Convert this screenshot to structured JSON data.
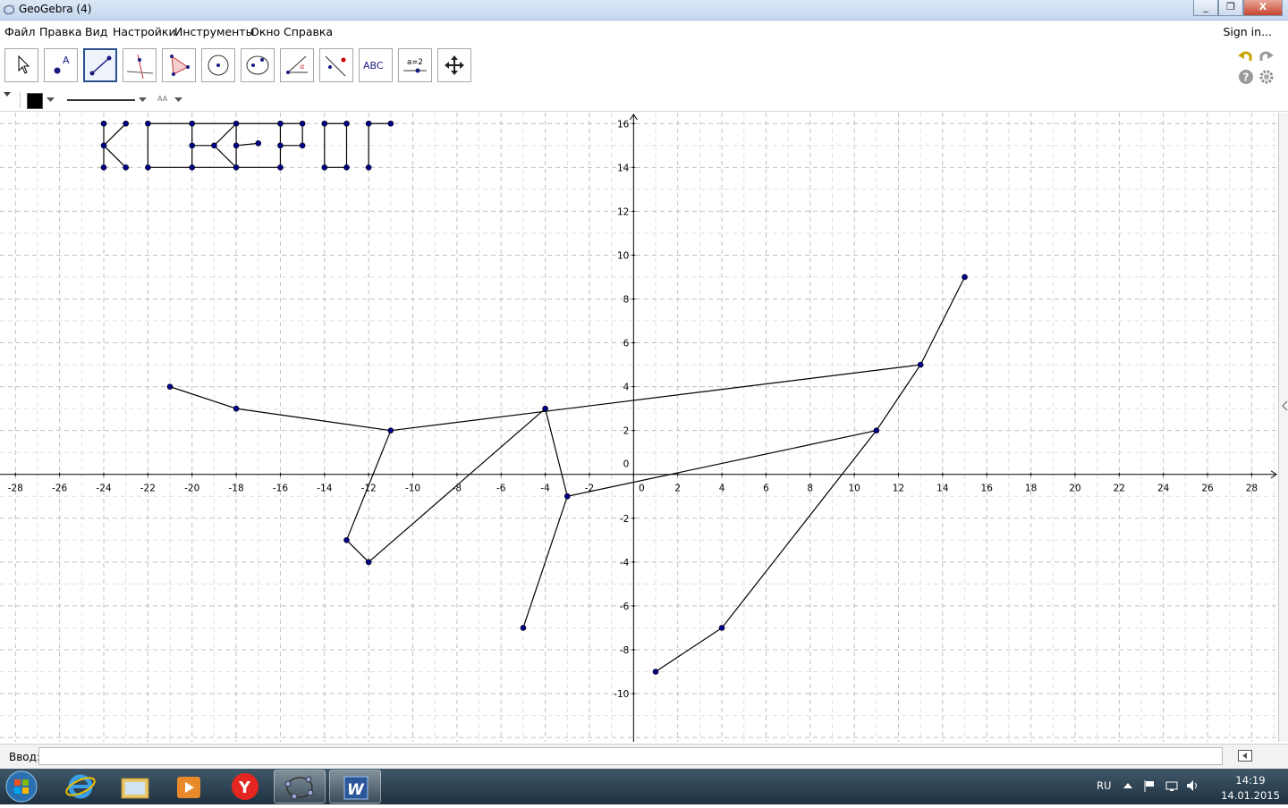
{
  "window": {
    "title": "GeoGebra (4)",
    "buttons": [
      "_",
      "❐",
      "X"
    ]
  },
  "menu": {
    "items": [
      "Файл",
      "Правка",
      "Вид",
      "Настройки",
      "Инструменты",
      "Окно",
      "Справка"
    ],
    "sign_in": "Sign in..."
  },
  "toolbar": {
    "tools": [
      "move-tool",
      "point-tool",
      "line-tool",
      "perpendicular-tool",
      "polygon-tool",
      "circle-tool",
      "conic-tool",
      "angle-tool",
      "reflect-tool",
      "text-tool",
      "slider-tool",
      "move-view-tool"
    ],
    "selected": "line-tool",
    "text_tool_label": "ABC",
    "slider_tool_label": "a=2"
  },
  "stylebar": {
    "color": "#000000",
    "text_size_label": "AA"
  },
  "graph": {
    "x_ticks": [
      "-28",
      "-26",
      "-24",
      "-22",
      "-20",
      "-18",
      "-16",
      "-14",
      "-12",
      "-10",
      "-8",
      "-6",
      "-4",
      "-2",
      "0",
      "2",
      "4",
      "6",
      "8",
      "10",
      "12",
      "14",
      "16",
      "18",
      "20",
      "22",
      "24",
      "26",
      "28"
    ],
    "y_ticks": [
      "16",
      "14",
      "12",
      "10",
      "8",
      "6",
      "4",
      "2",
      "0",
      "-2",
      "-4",
      "-6",
      "-8",
      "-10"
    ],
    "point_color": "#00008b",
    "line_color": "#000000"
  },
  "chart_data": {
    "type": "line",
    "grid": true,
    "xlim": [
      -28.7,
      29.2
    ],
    "ylim": [
      -12.2,
      16.5
    ],
    "series": [
      {
        "values": [
          [
            -21,
            4
          ],
          [
            -18,
            3
          ],
          [
            -11,
            2
          ],
          [
            -13,
            -3
          ],
          [
            -12,
            -4
          ],
          [
            -4,
            3
          ],
          [
            -3,
            -1
          ],
          [
            -5,
            -7
          ]
        ]
      },
      {
        "values": [
          [
            -11,
            2
          ],
          [
            13,
            5
          ],
          [
            15,
            9
          ]
        ]
      },
      {
        "values": [
          [
            -3,
            -1
          ],
          [
            11,
            2
          ],
          [
            4,
            -7
          ],
          [
            1,
            -9
          ]
        ]
      },
      {
        "values": [
          [
            13,
            5
          ],
          [
            11,
            2
          ]
        ]
      },
      {
        "values": [
          [
            -24,
            16
          ],
          [
            -24,
            14
          ]
        ]
      },
      {
        "values": [
          [
            -23,
            16
          ],
          [
            -24,
            15
          ],
          [
            -23,
            14
          ]
        ]
      },
      {
        "values": [
          [
            -22,
            16
          ],
          [
            -22,
            14
          ],
          [
            -20,
            14
          ],
          [
            -20,
            16
          ],
          [
            -22,
            16
          ]
        ]
      },
      {
        "values": [
          [
            -20,
            16
          ],
          [
            -18,
            16
          ],
          [
            -19,
            15
          ],
          [
            -18,
            14
          ],
          [
            -20,
            14
          ]
        ]
      },
      {
        "values": [
          [
            -20,
            15
          ],
          [
            -19,
            15
          ]
        ]
      },
      {
        "values": [
          [
            -18,
            16
          ],
          [
            -18,
            14
          ]
        ]
      },
      {
        "values": [
          [
            -18,
            16
          ],
          [
            -16,
            16
          ]
        ]
      },
      {
        "values": [
          [
            -18,
            15
          ],
          [
            -17,
            15.1
          ]
        ]
      },
      {
        "values": [
          [
            -18,
            14
          ],
          [
            -16,
            14
          ]
        ]
      },
      {
        "values": [
          [
            -16,
            16
          ],
          [
            -16,
            14
          ]
        ]
      },
      {
        "values": [
          [
            -16,
            16
          ],
          [
            -15,
            16
          ],
          [
            -15,
            15
          ],
          [
            -16,
            15
          ]
        ]
      },
      {
        "values": [
          [
            -14,
            16
          ],
          [
            -14,
            14
          ]
        ]
      },
      {
        "values": [
          [
            -14,
            16
          ],
          [
            -13,
            16
          ],
          [
            -13,
            14
          ],
          [
            -14,
            14
          ]
        ]
      },
      {
        "values": [
          [
            -12,
            16
          ],
          [
            -12,
            14
          ]
        ]
      },
      {
        "values": [
          [
            -12,
            16
          ],
          [
            -11,
            16
          ]
        ]
      }
    ]
  },
  "input_bar": {
    "label": "Ввод:",
    "value": ""
  },
  "taskbar": {
    "apps": [
      "start-button",
      "internet-explorer",
      "file-explorer",
      "media-player",
      "yandex-browser",
      "geogebra",
      "word"
    ],
    "language": "RU",
    "time": "14:19",
    "date": "14.01.2015"
  }
}
